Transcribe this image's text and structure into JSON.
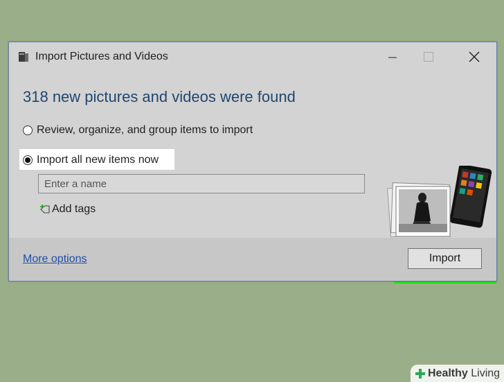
{
  "window": {
    "title": "Import Pictures and Videos",
    "controls": {
      "minimize": "minimize-icon",
      "maximize": "maximize-icon",
      "close": "close-icon"
    }
  },
  "heading": "318 new pictures and videos were found",
  "options": [
    {
      "label": "Review, organize, and group items to import",
      "selected": false
    },
    {
      "label": "Import all new items now",
      "selected": true
    }
  ],
  "name_field": {
    "placeholder": "Enter a name",
    "value": ""
  },
  "add_tags_label": "Add tags",
  "footer": {
    "more_options_label": "More options",
    "import_button_label": "Import"
  },
  "watermark": {
    "brand_bold": "Healthy",
    "brand_light": " Living"
  },
  "colors": {
    "highlight": "#22e11a",
    "heading": "#21466f",
    "link": "#1f4fa5",
    "background": "#9aaf89"
  }
}
